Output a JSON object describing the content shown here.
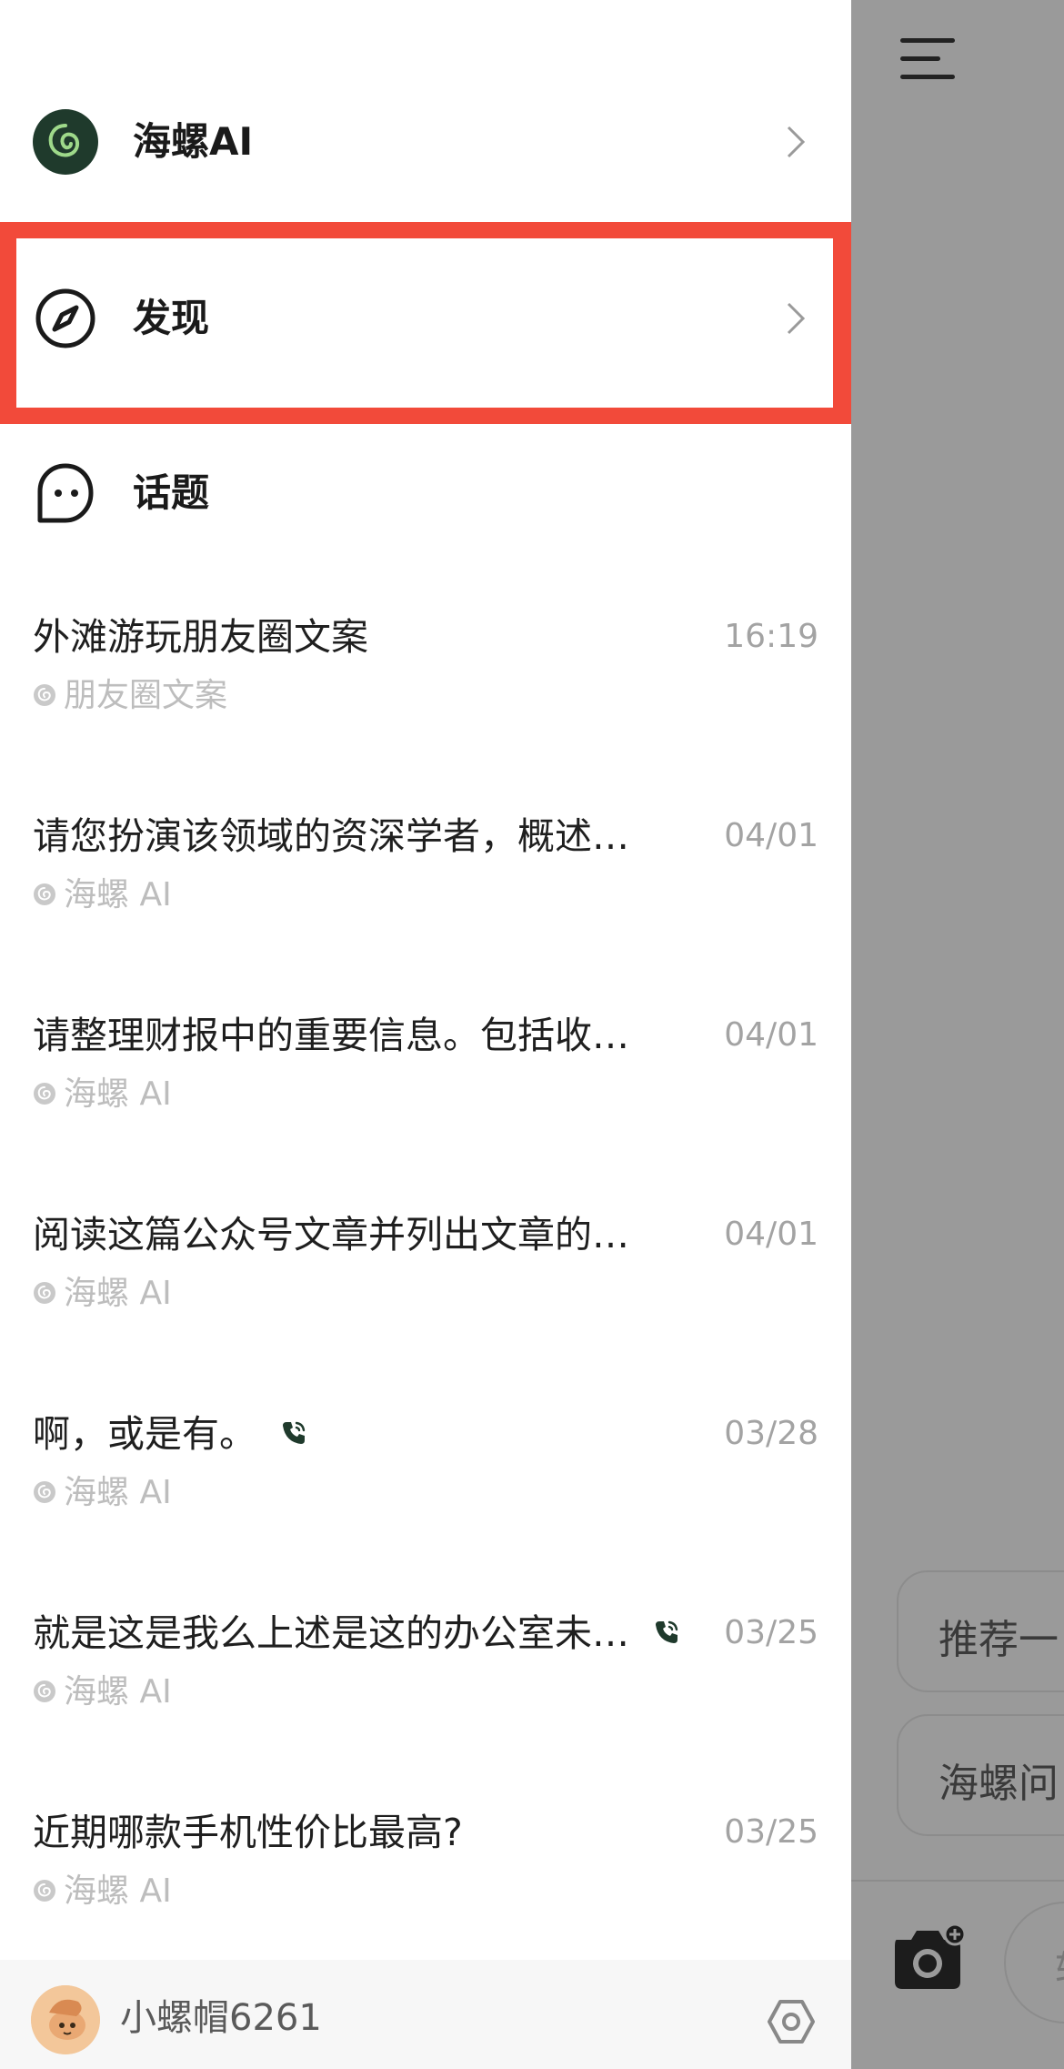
{
  "drawer": {
    "nav": [
      {
        "key": "ai",
        "label": "海螺AI",
        "icon": "hailuo-logo-icon"
      },
      {
        "key": "discover",
        "label": "发现",
        "icon": "compass-icon"
      },
      {
        "key": "topics",
        "label": "话题",
        "icon": "chat-bubble-icon"
      }
    ],
    "conversations": [
      {
        "title": "外滩游玩朋友圈文案",
        "time": "16:19",
        "source": "朋友圈文案",
        "call": false
      },
      {
        "title": "请您扮演该领域的资深学者，概述…",
        "time": "04/01",
        "source": "海螺 AI",
        "call": false
      },
      {
        "title": "请整理财报中的重要信息。包括收…",
        "time": "04/01",
        "source": "海螺 AI",
        "call": false
      },
      {
        "title": "阅读这篇公众号文章并列出文章的…",
        "time": "04/01",
        "source": "海螺 AI",
        "call": false
      },
      {
        "title": "啊，或是有。",
        "time": "03/28",
        "source": "海螺 AI",
        "call": true
      },
      {
        "title": "就是这是我么上述是这的办公室未…",
        "time": "03/25",
        "source": "海螺 AI",
        "call": true
      },
      {
        "title": "近期哪款手机性价比最高?",
        "time": "03/25",
        "source": "海螺 AI",
        "call": false
      }
    ],
    "footer": {
      "username": "小螺帽6261"
    }
  },
  "background": {
    "chips": [
      "推荐一",
      "海螺问"
    ],
    "input_placeholder": "转"
  },
  "colors": {
    "highlight": "#f24a3a",
    "brand_dark_green": "#1f3a2c",
    "overlay": "#9a9a9a"
  }
}
